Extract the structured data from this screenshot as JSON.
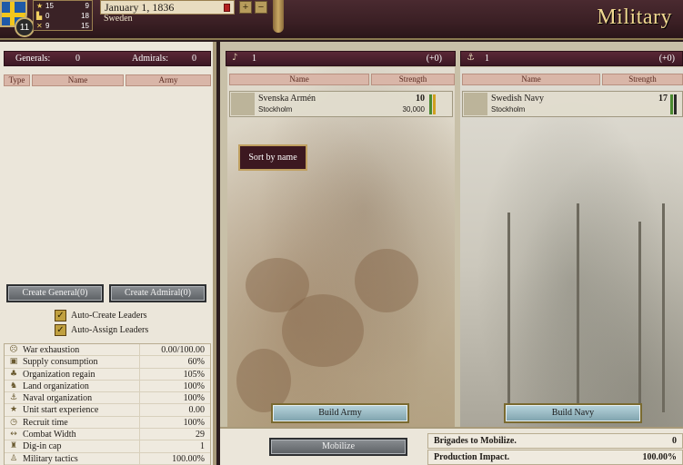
{
  "top_bar": {
    "rank": "11",
    "stats": [
      {
        "icon": "star-icon",
        "left": "15",
        "right": "9"
      },
      {
        "icon": "factory-icon",
        "left": "0",
        "right": "18"
      },
      {
        "icon": "crossed-swords-icon",
        "left": "9",
        "right": "15"
      }
    ],
    "date": "January 1, 1836",
    "country": "Sweden",
    "speed_up_label": "+",
    "speed_down_label": "−",
    "title": "Military"
  },
  "leaders": {
    "generals_label": "Generals:",
    "generals_count": "0",
    "admirals_label": "Admirals:",
    "admirals_count": "0",
    "columns": [
      "Type",
      "Name",
      "Army"
    ],
    "create_general": "Create General(0)",
    "create_admiral": "Create Admiral(0)",
    "auto_create": "Auto-Create Leaders",
    "auto_assign": "Auto-Assign Leaders",
    "check_mark": "✓"
  },
  "military_stats": [
    {
      "icon": "exhaustion-icon",
      "label": "War exhaustion",
      "value": "0.00/100.00"
    },
    {
      "icon": "supply-icon",
      "label": "Supply consumption",
      "value": "60%"
    },
    {
      "icon": "organization-icon",
      "label": "Organization regain",
      "value": "105%"
    },
    {
      "icon": "land-org-icon",
      "label": "Land organization",
      "value": "100%"
    },
    {
      "icon": "naval-org-icon",
      "label": "Naval organization",
      "value": "100%"
    },
    {
      "icon": "experience-icon",
      "label": "Unit start experience",
      "value": "0.00"
    },
    {
      "icon": "clock-icon",
      "label": "Recruit time",
      "value": "100%"
    },
    {
      "icon": "width-icon",
      "label": "Combat Width",
      "value": "29"
    },
    {
      "icon": "digin-icon",
      "label": "Dig-in cap",
      "value": "1"
    },
    {
      "icon": "tactics-icon",
      "label": "Military tactics",
      "value": "100.00%"
    }
  ],
  "army": {
    "count": "1",
    "change": "(+0)",
    "columns": [
      "Name",
      "Strength"
    ],
    "units": [
      {
        "name": "Svenska Armén",
        "location": "Stockholm",
        "strength": "10",
        "men": "30,000"
      }
    ],
    "sort_button": "Sort by name",
    "build_button": "Build Army"
  },
  "navy": {
    "count": "1",
    "change": "(+0)",
    "columns": [
      "Name",
      "Strength"
    ],
    "units": [
      {
        "name": "Swedish Navy",
        "location": "Stockholm",
        "strength": "17"
      }
    ],
    "build_button": "Build Navy"
  },
  "bottom": {
    "mobilize_button": "Mobilize",
    "brigades_label": "Brigades to Mobilize.",
    "brigades_value": "0",
    "production_label": "Production Impact.",
    "production_value": "100.00%"
  },
  "colors": {
    "header_maroon": "#3c1824",
    "accent_gold": "#c0a060",
    "panel_bg": "#ebe6da"
  }
}
